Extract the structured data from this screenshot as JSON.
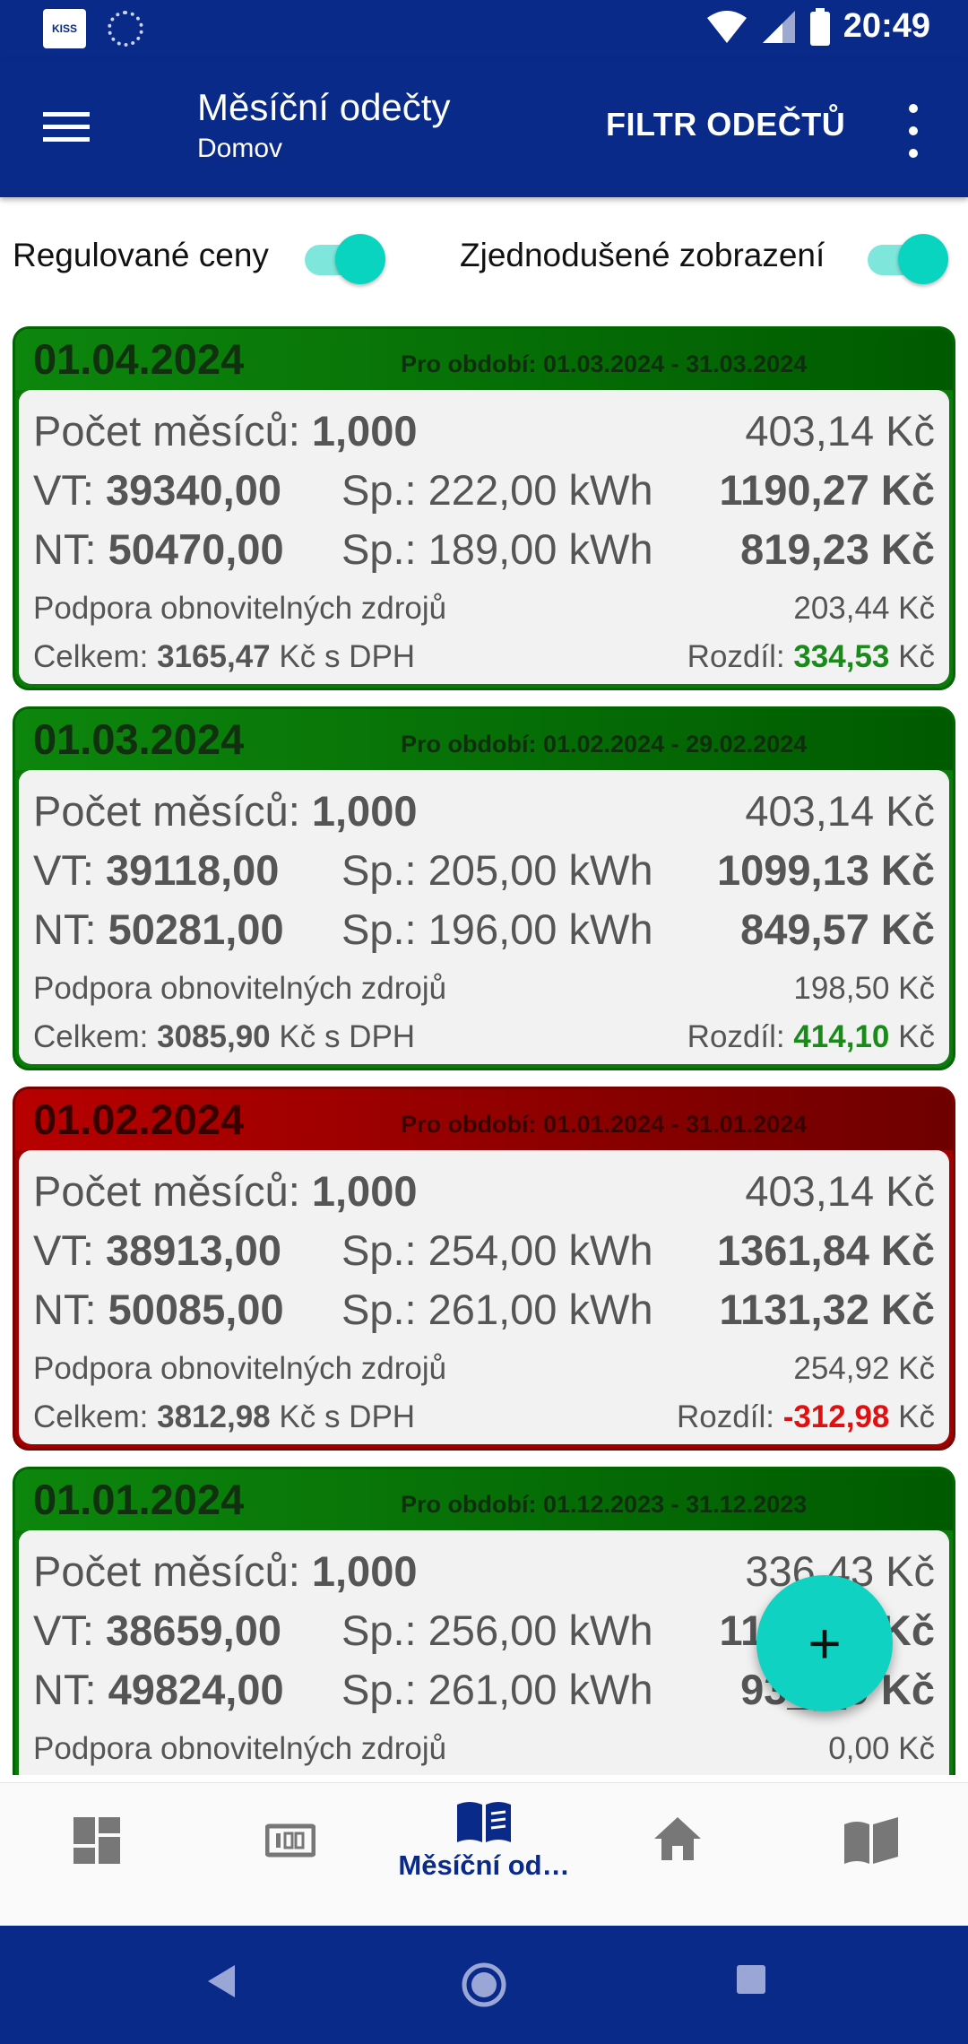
{
  "status_bar": {
    "time": "20:49",
    "kiss_logo": "KISS",
    "icons": [
      "kiss-app-icon",
      "sync-icon",
      "wifi-icon",
      "signal-icon",
      "battery-icon"
    ]
  },
  "app_bar": {
    "title": "Měsíční odečty",
    "subtitle": "Domov",
    "filter_label": "FILTR ODEČTŮ"
  },
  "toggles": {
    "regulated_label": "Regulované ceny",
    "regulated_on": true,
    "simplified_label": "Zjednodušené zobrazení",
    "simplified_on": true
  },
  "labels": {
    "months": "Počet měsíců:",
    "vt": "VT:",
    "nt": "NT:",
    "sp": "Sp.:",
    "support": "Podpora obnovitelných zdrojů",
    "total": "Celkem:",
    "total_suffix": "Kč s DPH",
    "diff": "Rozdíl:",
    "currency": "Kč"
  },
  "readings": [
    {
      "date": "01.04.2024",
      "period": "Pro období: 01.03.2024 - 31.03.2024",
      "status": "green",
      "months": "1,000",
      "fixed_cost": "403,14 Kč",
      "vt_value": "39340,00",
      "vt_consumption": "222,00 kWh",
      "vt_cost": "1190,27 Kč",
      "nt_value": "50470,00",
      "nt_consumption": "189,00 kWh",
      "nt_cost": "819,23 Kč",
      "support_cost": "203,44 Kč",
      "total": "3165,47",
      "difference": "334,53"
    },
    {
      "date": "01.03.2024",
      "period": "Pro období: 01.02.2024 - 29.02.2024",
      "status": "green",
      "months": "1,000",
      "fixed_cost": "403,14 Kč",
      "vt_value": "39118,00",
      "vt_consumption": "205,00 kWh",
      "vt_cost": "1099,13 Kč",
      "nt_value": "50281,00",
      "nt_consumption": "196,00 kWh",
      "nt_cost": "849,57 Kč",
      "support_cost": "198,50 Kč",
      "total": "3085,90",
      "difference": "414,10"
    },
    {
      "date": "01.02.2024",
      "period": "Pro období: 01.01.2024 - 31.01.2024",
      "status": "red",
      "months": "1,000",
      "fixed_cost": "403,14 Kč",
      "vt_value": "38913,00",
      "vt_consumption": "254,00 kWh",
      "vt_cost": "1361,84 Kč",
      "nt_value": "50085,00",
      "nt_consumption": "261,00 kWh",
      "nt_cost": "1131,32 Kč",
      "support_cost": "254,92 Kč",
      "total": "3812,98",
      "difference": "-312,98"
    },
    {
      "date": "01.01.2024",
      "period": "Pro období: 01.12.2023 - 31.12.2023",
      "status": "green",
      "months": "1,000",
      "fixed_cost": "336,43 Kč",
      "vt_value": "38659,00",
      "vt_consumption": "256,00 kWh",
      "vt_cost": "11__,__ Kč",
      "nt_value": "49824,00",
      "nt_consumption": "261,00 kWh",
      "nt_cost": "93_,_9 Kč",
      "support_cost": "0,00 Kč"
    }
  ],
  "fab": {
    "icon": "plus-icon",
    "symbol": "+"
  },
  "bottom_nav": {
    "items": [
      {
        "icon": "dashboard-icon",
        "label": ""
      },
      {
        "icon": "meter-icon",
        "label": ""
      },
      {
        "icon": "book-icon",
        "label": "Měsíční od…",
        "active": true
      },
      {
        "icon": "home-icon",
        "label": ""
      },
      {
        "icon": "map-icon",
        "label": ""
      }
    ]
  },
  "colors": {
    "primary": "#0a2a8a",
    "accent": "#10d2c2",
    "positive": "#1a8a1a",
    "negative": "#e01010",
    "card_green": "#0b7a0b",
    "card_red": "#a00000"
  }
}
